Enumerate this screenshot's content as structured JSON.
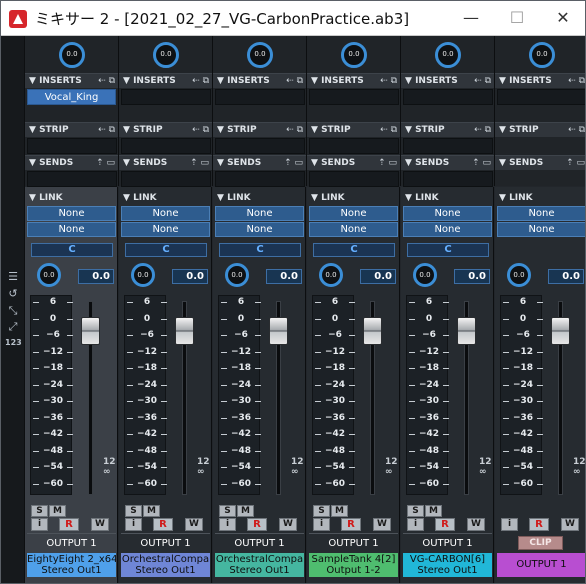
{
  "window": {
    "title": "ミキサー 2 - [2021_02_27_VG-CarbonPractice.ab3]",
    "min_glyph": "—",
    "max_glyph": "☐",
    "close_glyph": "✕"
  },
  "rail": {
    "icons": [
      "bars-icon",
      "undo-icon",
      "collapse-icon",
      "expand-icon"
    ],
    "label_123": "123"
  },
  "sections": {
    "inserts": "INSERTS",
    "strip": "STRIP",
    "sends": "SENDS",
    "link": "LINK"
  },
  "top_knob_value": "0.0",
  "channels": [
    {
      "name_line1": "EightyEight 2_x64]",
      "name_line2": "Stereo Out1",
      "insert": "Vocal_King",
      "link1": "None",
      "link2": "None",
      "c_label": "C",
      "pan_knob": "0.0",
      "pan_value": "0.0",
      "output": "OUTPUT 1",
      "color": "#4fa0ea",
      "selected": true
    },
    {
      "name_line1": "OrchestralCompa",
      "name_line2": "Stereo Out1",
      "insert": "",
      "link1": "None",
      "link2": "None",
      "c_label": "C",
      "pan_knob": "0.0",
      "pan_value": "0.0",
      "output": "OUTPUT 1",
      "color": "#6f86d6",
      "selected": false
    },
    {
      "name_line1": "OrchestralCompa",
      "name_line2": "Stereo Out1",
      "insert": "",
      "link1": "None",
      "link2": "None",
      "c_label": "C",
      "pan_knob": "0.0",
      "pan_value": "0.0",
      "output": "OUTPUT 1",
      "color": "#45b6a0",
      "selected": false
    },
    {
      "name_line1": "SampleTank 4[2]",
      "name_line2": "Output 1-2",
      "insert": "",
      "link1": "None",
      "link2": "None",
      "c_label": "C",
      "pan_knob": "0.0",
      "pan_value": "0.0",
      "output": "OUTPUT 1",
      "color": "#4fbd6f",
      "selected": false
    },
    {
      "name_line1": "VG-CARBON[6]",
      "name_line2": "Stereo Out1",
      "insert": "",
      "link1": "None",
      "link2": "None",
      "c_label": "C",
      "pan_knob": "0.0",
      "pan_value": "0.0",
      "output": "OUTPUT 1",
      "color": "#21b7d8",
      "selected": false
    },
    {
      "name_line1": "OUTPUT 1",
      "name_line2": "",
      "insert": "",
      "link1": "None",
      "link2": "None",
      "c_label": "",
      "pan_knob": "0.0",
      "pan_value": "0.0",
      "output": "",
      "clip": "CLIP",
      "color": "#b84ed1",
      "selected": false
    }
  ],
  "fader_scale": [
    "6",
    "0",
    "−6",
    "−12",
    "−18",
    "−24",
    "−30",
    "−36",
    "−42",
    "−48",
    "−54",
    "−60"
  ],
  "scale_inf": [
    "12",
    "∞"
  ],
  "buttons": {
    "s": "S",
    "m": "M",
    "i": "i",
    "r": "R",
    "w": "W"
  }
}
